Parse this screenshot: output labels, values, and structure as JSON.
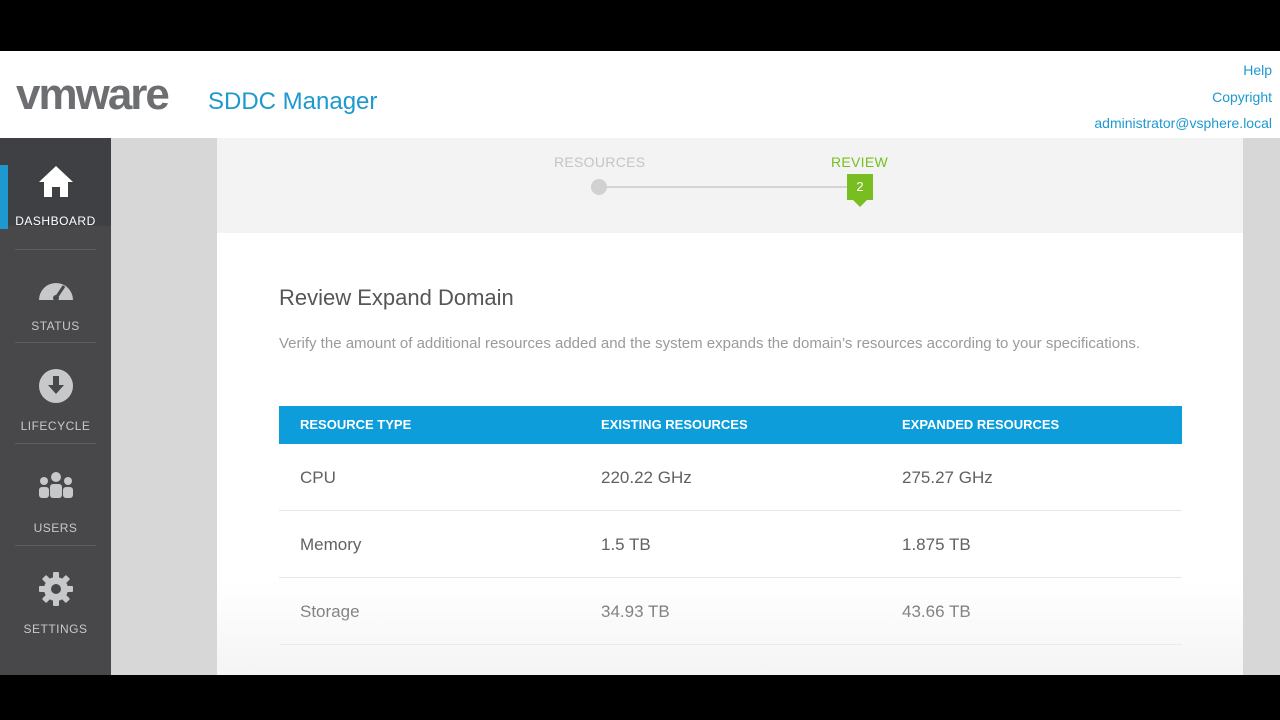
{
  "header": {
    "logo_text": "vmware",
    "product_name": "SDDC Manager",
    "links": [
      "Help",
      "Copyright",
      "administrator@vsphere.local"
    ]
  },
  "sidebar": {
    "items": [
      {
        "label": "DASHBOARD",
        "icon": "home-icon",
        "active": true
      },
      {
        "label": "STATUS",
        "icon": "gauge-icon",
        "active": false
      },
      {
        "label": "LIFECYCLE",
        "icon": "download-circle-icon",
        "active": false
      },
      {
        "label": "USERS",
        "icon": "users-icon",
        "active": false
      },
      {
        "label": "SETTINGS",
        "icon": "gear-icon",
        "active": false
      }
    ]
  },
  "wizard": {
    "steps": [
      {
        "label": "RESOURCES"
      },
      {
        "label": "REVIEW",
        "number": "2"
      }
    ],
    "current_step": "REVIEW"
  },
  "content": {
    "title": "Review Expand Domain",
    "description": "Verify the amount of additional resources added and the system expands the domain’s resources according to your specifications."
  },
  "table": {
    "headers": [
      "RESOURCE TYPE",
      "EXISTING RESOURCES",
      "EXPANDED RESOURCES"
    ],
    "rows": [
      [
        "CPU",
        "220.22 GHz",
        "275.27 GHz"
      ],
      [
        "Memory",
        "1.5 TB",
        "1.875 TB"
      ],
      [
        "Storage",
        "34.93 TB",
        "43.66 TB"
      ]
    ]
  },
  "colors": {
    "accent": "#1d99cf",
    "table_header": "#0d9ddb",
    "step_active": "#78be20",
    "sidebar": "#48484b"
  }
}
